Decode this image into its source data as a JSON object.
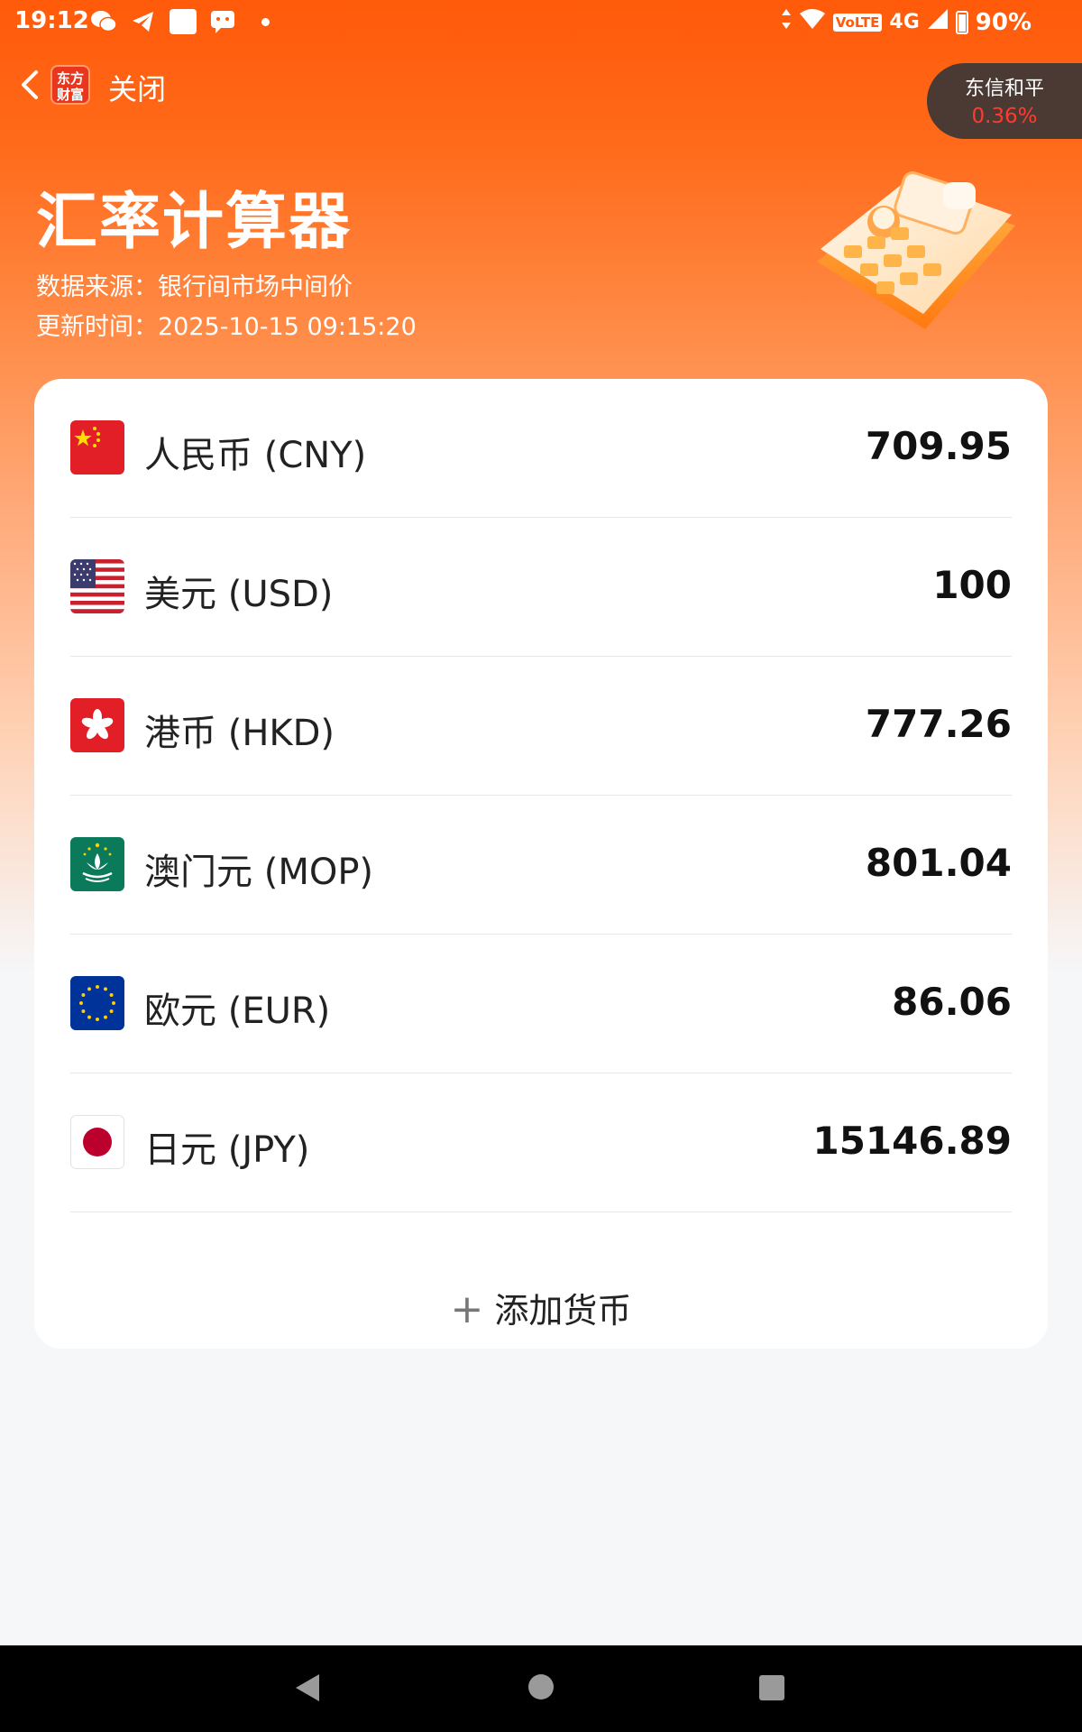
{
  "status_bar": {
    "time": "19:12",
    "network_badge": "VoLTE",
    "network": "4G",
    "battery": "90%"
  },
  "nav": {
    "back_icon": "chevron-left-icon",
    "brand_logo_text": "东方财富",
    "close_label": "关闭"
  },
  "stock_pill": {
    "name": "东信和平",
    "change": "0.36%",
    "change_color": "#ff3b30"
  },
  "header": {
    "title": "汇率计算器",
    "source": "数据来源：银行间市场中间价",
    "updated": "更新时间：2025-10-15 09:15:20",
    "illustration_icon": "calculator-illustration"
  },
  "currencies": [
    {
      "name": "人民币 (CNY)",
      "value": "709.95",
      "flag": "cn-flag-icon"
    },
    {
      "name": "美元 (USD)",
      "value": "100",
      "flag": "us-flag-icon"
    },
    {
      "name": "港币 (HKD)",
      "value": "777.26",
      "flag": "hk-flag-icon"
    },
    {
      "name": "澳门元 (MOP)",
      "value": "801.04",
      "flag": "mo-flag-icon"
    },
    {
      "name": "欧元 (EUR)",
      "value": "86.06",
      "flag": "eu-flag-icon"
    },
    {
      "name": "日元 (JPY)",
      "value": "15146.89",
      "flag": "jp-flag-icon"
    }
  ],
  "add_currency": {
    "icon": "plus-icon",
    "label": "添加货币"
  },
  "colors": {
    "accent": "#ff5a0a",
    "background": "#f6f7f9"
  }
}
